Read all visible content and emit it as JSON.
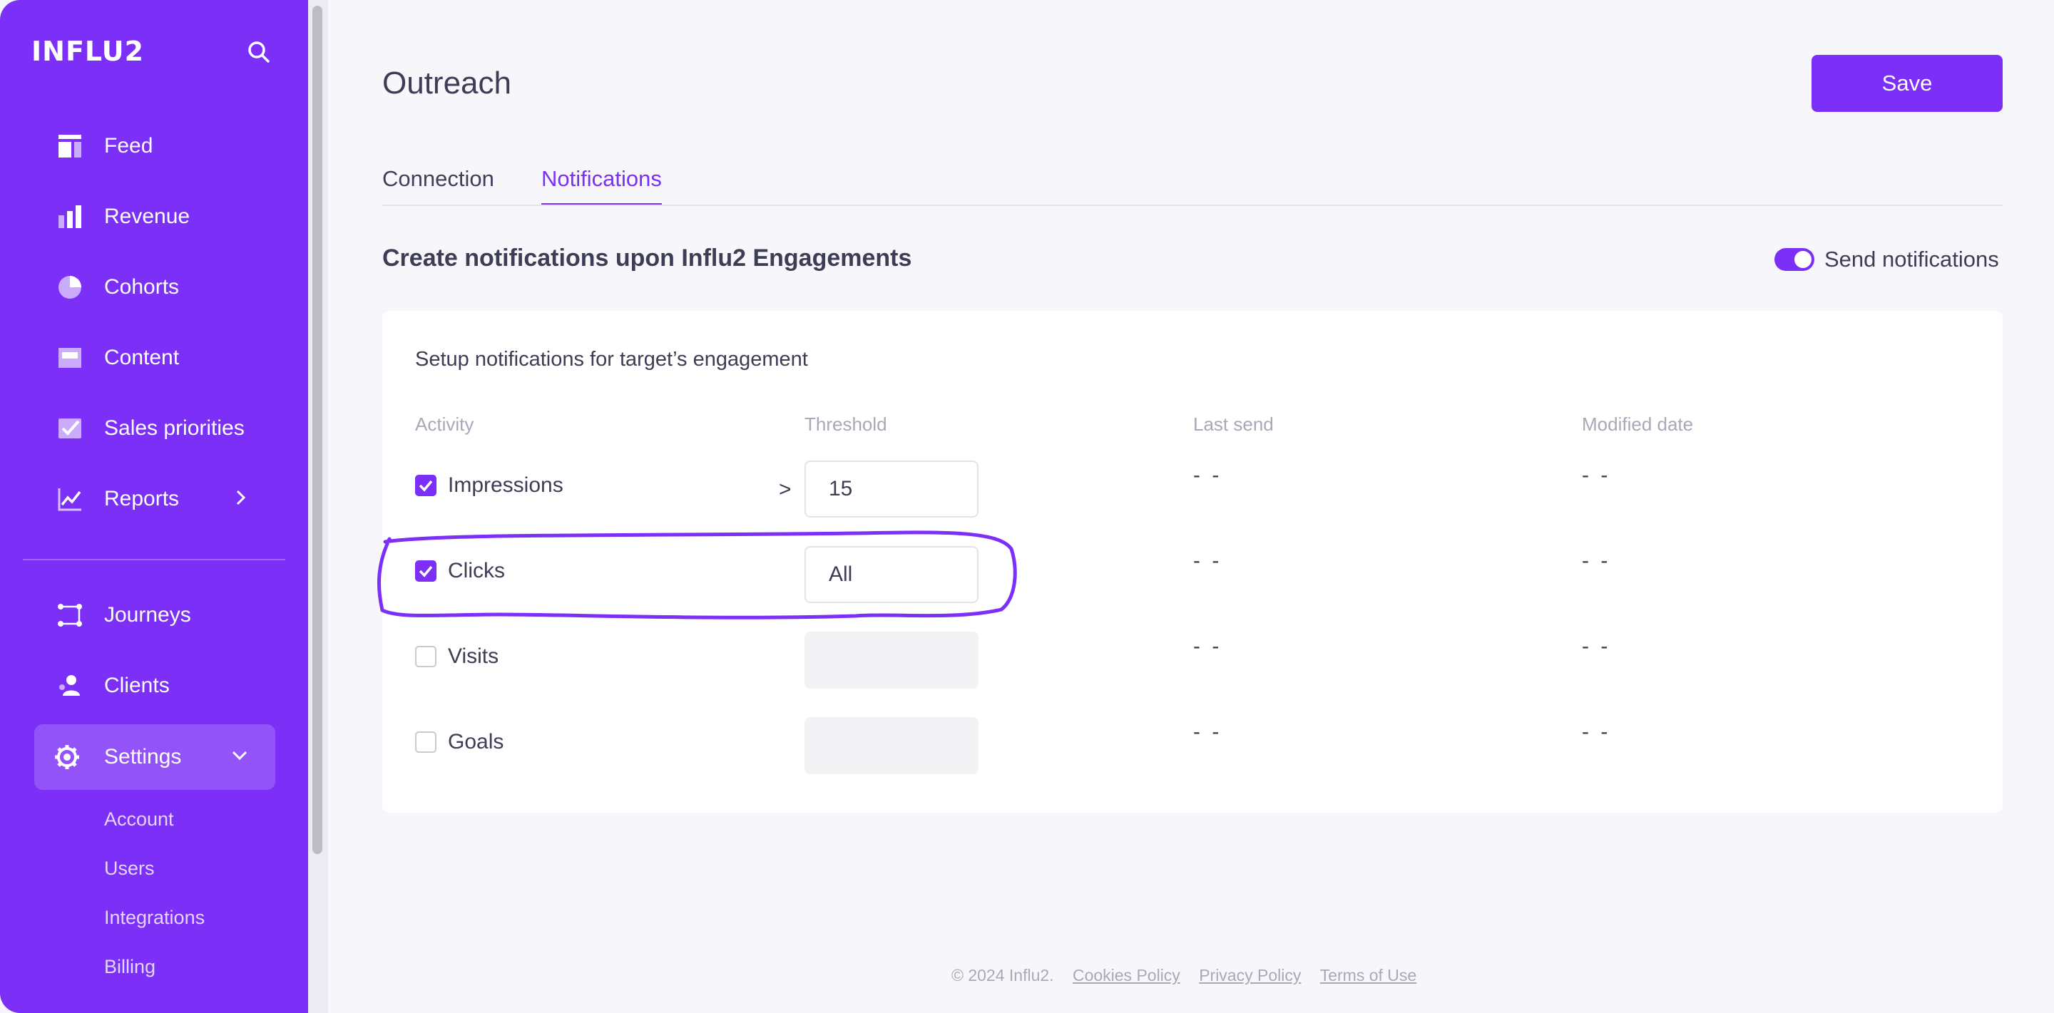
{
  "brand": {
    "logo": "INFLU2",
    "accent": "#7b2ff7"
  },
  "sidebar": {
    "items": [
      {
        "label": "Feed",
        "icon": "feed-icon"
      },
      {
        "label": "Revenue",
        "icon": "bar-chart-icon"
      },
      {
        "label": "Cohorts",
        "icon": "pie-chart-icon"
      },
      {
        "label": "Content",
        "icon": "content-icon"
      },
      {
        "label": "Sales priorities",
        "icon": "checkmark-icon"
      },
      {
        "label": "Reports",
        "icon": "line-chart-icon"
      },
      {
        "label": "Journeys",
        "icon": "journeys-icon"
      },
      {
        "label": "Clients",
        "icon": "clients-icon"
      },
      {
        "label": "Settings",
        "icon": "gear-icon"
      }
    ],
    "settings_sub": [
      "Account",
      "Users",
      "Integrations",
      "Billing"
    ]
  },
  "page": {
    "title": "Outreach",
    "save_label": "Save",
    "tabs": [
      {
        "label": "Connection",
        "active": false
      },
      {
        "label": "Notifications",
        "active": true
      }
    ],
    "section_title": "Create notifications upon Influ2 Engagements",
    "toggle_label": "Send notifications",
    "toggle_on": true
  },
  "card": {
    "title": "Setup notifications for target’s engagement",
    "columns": [
      "Activity",
      "Threshold",
      "Last send",
      "Modified date"
    ],
    "rows": [
      {
        "activity": "Impressions",
        "checked": true,
        "operator": ">",
        "threshold": "15",
        "last_send": "- -",
        "modified": "- -"
      },
      {
        "activity": "Clicks",
        "checked": true,
        "operator": "",
        "threshold": "All",
        "last_send": "- -",
        "modified": "- -"
      },
      {
        "activity": "Visits",
        "checked": false,
        "operator": "",
        "threshold": "",
        "last_send": "- -",
        "modified": "- -"
      },
      {
        "activity": "Goals",
        "checked": false,
        "operator": "",
        "threshold": "",
        "last_send": "- -",
        "modified": "- -"
      }
    ]
  },
  "footer": {
    "copyright": "© 2024 Influ2.",
    "links": [
      "Cookies Policy",
      "Privacy Policy",
      "Terms of Use"
    ]
  }
}
